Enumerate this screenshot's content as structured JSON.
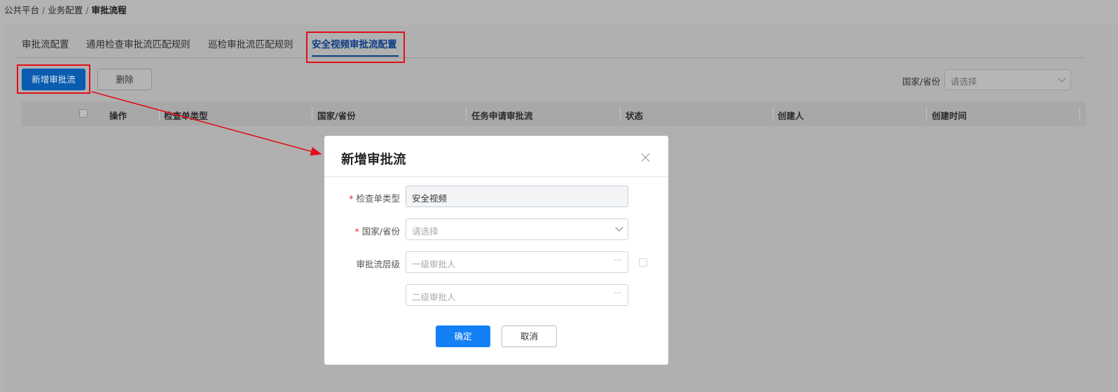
{
  "breadcrumb": {
    "items": [
      "公共平台",
      "业务配置"
    ],
    "separator": "/",
    "current": "审批流程"
  },
  "tabs": [
    {
      "label": "审批流配置",
      "active": false
    },
    {
      "label": "通用检查审批流匹配规则",
      "active": false
    },
    {
      "label": "巡检审批流匹配规则",
      "active": false
    },
    {
      "label": "安全视频审批流配置",
      "active": true
    }
  ],
  "toolbar": {
    "add_label": "新增审批流",
    "delete_label": "删除"
  },
  "filter": {
    "label": "国家/省份",
    "placeholder": "请选择"
  },
  "table": {
    "columns": [
      "操作",
      "检查单类型",
      "国家/省份",
      "任务申请审批流",
      "状态",
      "创建人",
      "创建时间"
    ]
  },
  "modal": {
    "title": "新增审批流",
    "fields": {
      "type": {
        "label": "检查单类型",
        "required": true,
        "value": "安全视频"
      },
      "region": {
        "label": "国家/省份",
        "required": true,
        "placeholder": "请选择"
      },
      "levels": {
        "label": "审批流层级",
        "first_placeholder": "一级审批人",
        "second_placeholder": "二级审批人"
      }
    },
    "ok_label": "确定",
    "cancel_label": "取消",
    "required_mark": "*",
    "ellipsis": "···"
  },
  "colors": {
    "primary": "#1480f5",
    "tab_active": "#0b3d85",
    "annotation": "#e0101a",
    "required": "#f5222d"
  }
}
